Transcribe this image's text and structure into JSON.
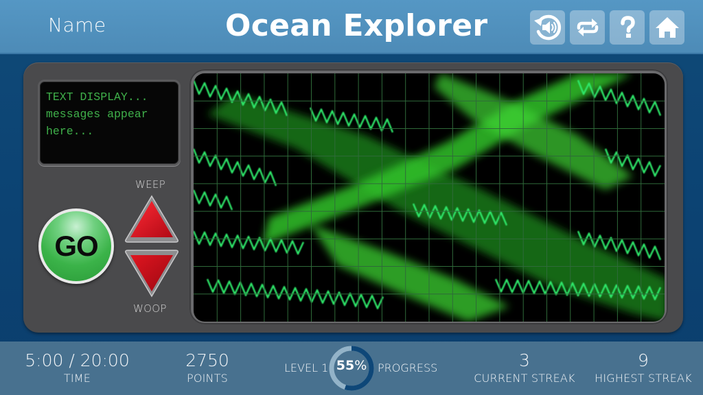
{
  "header": {
    "name_label": "Name",
    "title": "Ocean Explorer",
    "buttons": [
      {
        "id": "replay-audio",
        "icon": "replay-audio-icon"
      },
      {
        "id": "swap",
        "icon": "swap-arrows-icon"
      },
      {
        "id": "help",
        "icon": "question-mark-icon"
      },
      {
        "id": "home",
        "icon": "home-icon"
      }
    ]
  },
  "console": {
    "text_display": "TEXT DISPLAY...\nmessages appear\nhere...",
    "go_label": "GO",
    "up_label": "WEEP",
    "down_label": "WOOP",
    "colors": {
      "screen_text": "#3fb04a",
      "go_button": "#3bb349",
      "arrow_button": "#d4101c",
      "scope_grid": "#2f6a3a",
      "scope_trace": "#2ee86a"
    }
  },
  "footer": {
    "time": {
      "value": "5:00 / 20:00",
      "label": "TIME"
    },
    "points": {
      "value": "2750",
      "label": "POINTS"
    },
    "level": {
      "label": "LEVEL 1"
    },
    "progress": {
      "percent_number": "55",
      "percent_sign": "%",
      "fraction": 0.55,
      "label": "PROGRESS"
    },
    "current_streak": {
      "value": "3",
      "label": "CURRENT STREAK"
    },
    "highest_streak": {
      "value": "9",
      "label": "HIGHEST STREAK"
    }
  }
}
